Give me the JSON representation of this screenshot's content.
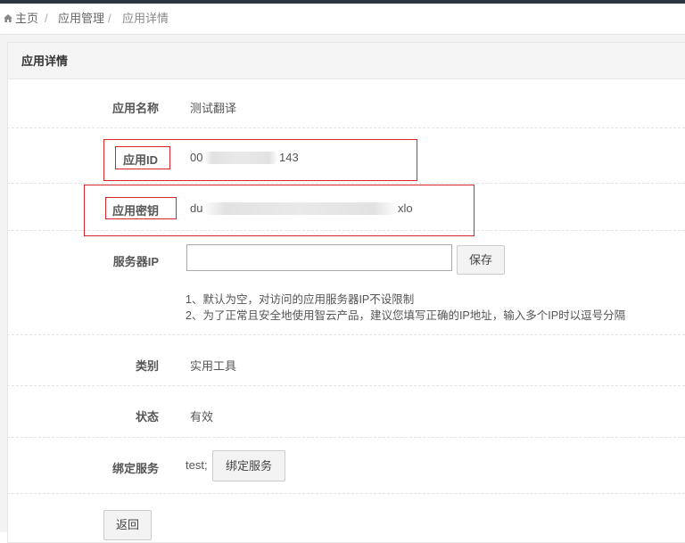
{
  "breadcrumb": {
    "home": "主页",
    "separator": "/",
    "level1": "应用管理",
    "level2": "应用详情",
    "home_icon": "home-icon"
  },
  "panel": {
    "title": "应用详情"
  },
  "fields": {
    "app_name": {
      "label": "应用名称",
      "value": "测试翻译"
    },
    "app_id": {
      "label": "应用ID",
      "value_prefix": "00",
      "value_suffix": "143"
    },
    "app_secret": {
      "label": "应用密钥",
      "value_prefix": "du",
      "value_suffix": "xlo"
    },
    "server_ip": {
      "label": "服务器IP",
      "input_value": "",
      "save_label": "保存",
      "hints": [
        "1、默认为空，对访问的应用服务器IP不设限制",
        "2、为了正常且安全地使用智云产品，建议您填写正确的IP地址，输入多个IP时以逗号分隔"
      ]
    },
    "category": {
      "label": "类别",
      "value": "实用工具"
    },
    "status": {
      "label": "状态",
      "value": "有效"
    },
    "bound_service": {
      "label": "绑定服务",
      "value": "test;",
      "button_label": "绑定服务"
    }
  },
  "back_label": "返回",
  "colors": {
    "topbar": "#2b3542",
    "highlight_border": "#d9242a",
    "page_background": "#f3f3f4"
  }
}
